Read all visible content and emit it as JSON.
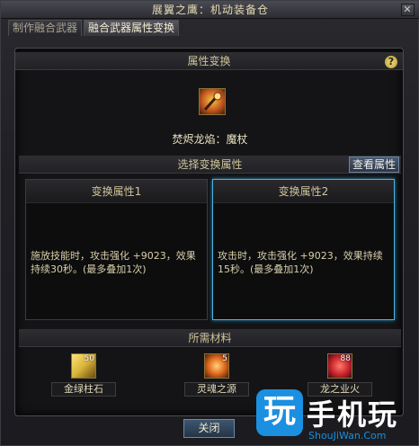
{
  "window": {
    "title": "展翼之鹰：机动装备仓",
    "close_symbol": "✕"
  },
  "tabs": [
    {
      "label": "制作融合武器",
      "active": false
    },
    {
      "label": "融合武器属性变换",
      "active": true
    }
  ],
  "transform": {
    "header": "属性变换",
    "help_symbol": "?",
    "weapon_name": "焚烬龙焰：魔杖"
  },
  "select": {
    "header": "选择变换属性",
    "view_button": "查看属性",
    "options": [
      {
        "title": "变换属性1",
        "description": "施放技能时，攻击强化 +9023，效果持续30秒。(最多叠加1次)",
        "selected": false
      },
      {
        "title": "变换属性2",
        "description": "攻击时，攻击强化 +9023，效果持续15秒。(最多叠加1次)",
        "selected": true
      }
    ]
  },
  "materials": {
    "header": "所需材料",
    "items": [
      {
        "name": "金绿柱石",
        "count": "50",
        "icon": "gem-icon",
        "color": "#d9b43a"
      },
      {
        "name": "灵魂之源",
        "count": "5",
        "icon": "soul-icon",
        "color": "#e06a1e"
      },
      {
        "name": "龙之业火",
        "count": "88",
        "icon": "dragon-fire-icon",
        "color": "#c8242c"
      }
    ]
  },
  "footer": {
    "close_label": "关闭"
  },
  "watermark": {
    "glyph": "玩",
    "text": "手机玩",
    "sub": "ShouJiWan.Com"
  }
}
